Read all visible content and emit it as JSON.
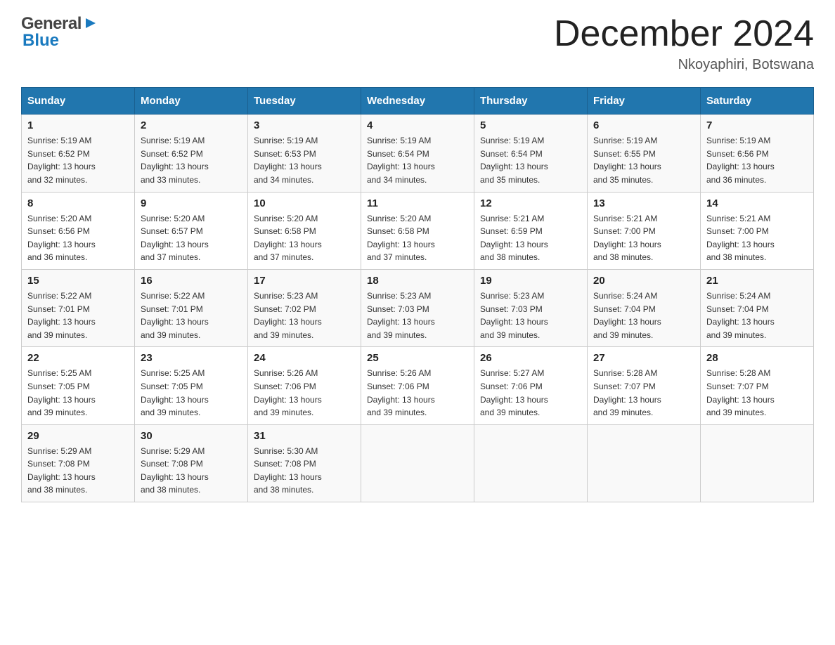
{
  "header": {
    "logo_general": "General",
    "logo_blue": "Blue",
    "month_title": "December 2024",
    "location": "Nkoyaphiri, Botswana"
  },
  "weekdays": [
    "Sunday",
    "Monday",
    "Tuesday",
    "Wednesday",
    "Thursday",
    "Friday",
    "Saturday"
  ],
  "weeks": [
    [
      {
        "day": "1",
        "sunrise": "5:19 AM",
        "sunset": "6:52 PM",
        "daylight": "13 hours and 32 minutes."
      },
      {
        "day": "2",
        "sunrise": "5:19 AM",
        "sunset": "6:52 PM",
        "daylight": "13 hours and 33 minutes."
      },
      {
        "day": "3",
        "sunrise": "5:19 AM",
        "sunset": "6:53 PM",
        "daylight": "13 hours and 34 minutes."
      },
      {
        "day": "4",
        "sunrise": "5:19 AM",
        "sunset": "6:54 PM",
        "daylight": "13 hours and 34 minutes."
      },
      {
        "day": "5",
        "sunrise": "5:19 AM",
        "sunset": "6:54 PM",
        "daylight": "13 hours and 35 minutes."
      },
      {
        "day": "6",
        "sunrise": "5:19 AM",
        "sunset": "6:55 PM",
        "daylight": "13 hours and 35 minutes."
      },
      {
        "day": "7",
        "sunrise": "5:19 AM",
        "sunset": "6:56 PM",
        "daylight": "13 hours and 36 minutes."
      }
    ],
    [
      {
        "day": "8",
        "sunrise": "5:20 AM",
        "sunset": "6:56 PM",
        "daylight": "13 hours and 36 minutes."
      },
      {
        "day": "9",
        "sunrise": "5:20 AM",
        "sunset": "6:57 PM",
        "daylight": "13 hours and 37 minutes."
      },
      {
        "day": "10",
        "sunrise": "5:20 AM",
        "sunset": "6:58 PM",
        "daylight": "13 hours and 37 minutes."
      },
      {
        "day": "11",
        "sunrise": "5:20 AM",
        "sunset": "6:58 PM",
        "daylight": "13 hours and 37 minutes."
      },
      {
        "day": "12",
        "sunrise": "5:21 AM",
        "sunset": "6:59 PM",
        "daylight": "13 hours and 38 minutes."
      },
      {
        "day": "13",
        "sunrise": "5:21 AM",
        "sunset": "7:00 PM",
        "daylight": "13 hours and 38 minutes."
      },
      {
        "day": "14",
        "sunrise": "5:21 AM",
        "sunset": "7:00 PM",
        "daylight": "13 hours and 38 minutes."
      }
    ],
    [
      {
        "day": "15",
        "sunrise": "5:22 AM",
        "sunset": "7:01 PM",
        "daylight": "13 hours and 39 minutes."
      },
      {
        "day": "16",
        "sunrise": "5:22 AM",
        "sunset": "7:01 PM",
        "daylight": "13 hours and 39 minutes."
      },
      {
        "day": "17",
        "sunrise": "5:23 AM",
        "sunset": "7:02 PM",
        "daylight": "13 hours and 39 minutes."
      },
      {
        "day": "18",
        "sunrise": "5:23 AM",
        "sunset": "7:03 PM",
        "daylight": "13 hours and 39 minutes."
      },
      {
        "day": "19",
        "sunrise": "5:23 AM",
        "sunset": "7:03 PM",
        "daylight": "13 hours and 39 minutes."
      },
      {
        "day": "20",
        "sunrise": "5:24 AM",
        "sunset": "7:04 PM",
        "daylight": "13 hours and 39 minutes."
      },
      {
        "day": "21",
        "sunrise": "5:24 AM",
        "sunset": "7:04 PM",
        "daylight": "13 hours and 39 minutes."
      }
    ],
    [
      {
        "day": "22",
        "sunrise": "5:25 AM",
        "sunset": "7:05 PM",
        "daylight": "13 hours and 39 minutes."
      },
      {
        "day": "23",
        "sunrise": "5:25 AM",
        "sunset": "7:05 PM",
        "daylight": "13 hours and 39 minutes."
      },
      {
        "day": "24",
        "sunrise": "5:26 AM",
        "sunset": "7:06 PM",
        "daylight": "13 hours and 39 minutes."
      },
      {
        "day": "25",
        "sunrise": "5:26 AM",
        "sunset": "7:06 PM",
        "daylight": "13 hours and 39 minutes."
      },
      {
        "day": "26",
        "sunrise": "5:27 AM",
        "sunset": "7:06 PM",
        "daylight": "13 hours and 39 minutes."
      },
      {
        "day": "27",
        "sunrise": "5:28 AM",
        "sunset": "7:07 PM",
        "daylight": "13 hours and 39 minutes."
      },
      {
        "day": "28",
        "sunrise": "5:28 AM",
        "sunset": "7:07 PM",
        "daylight": "13 hours and 39 minutes."
      }
    ],
    [
      {
        "day": "29",
        "sunrise": "5:29 AM",
        "sunset": "7:08 PM",
        "daylight": "13 hours and 38 minutes."
      },
      {
        "day": "30",
        "sunrise": "5:29 AM",
        "sunset": "7:08 PM",
        "daylight": "13 hours and 38 minutes."
      },
      {
        "day": "31",
        "sunrise": "5:30 AM",
        "sunset": "7:08 PM",
        "daylight": "13 hours and 38 minutes."
      },
      null,
      null,
      null,
      null
    ]
  ],
  "labels": {
    "sunrise": "Sunrise:",
    "sunset": "Sunset:",
    "daylight": "Daylight:"
  }
}
